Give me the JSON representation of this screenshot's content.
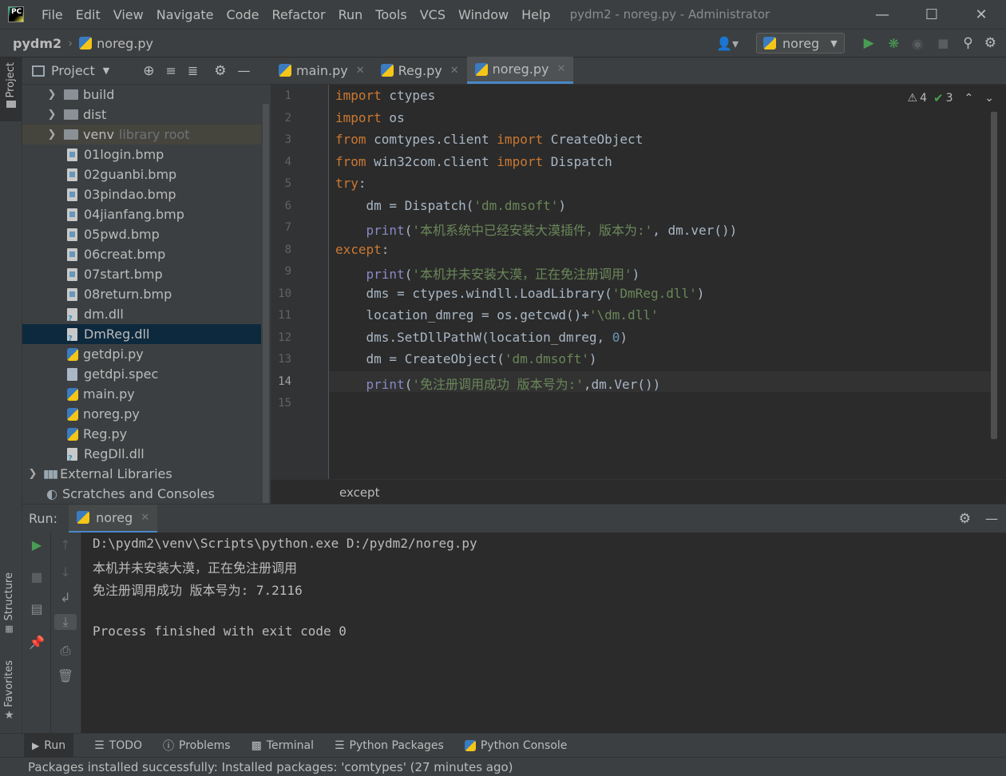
{
  "title_bar": {
    "menus": [
      "File",
      "Edit",
      "View",
      "Navigate",
      "Code",
      "Refactor",
      "Run",
      "Tools",
      "VCS",
      "Window",
      "Help"
    ],
    "window_title": "pydm2 - noreg.py - Administrator"
  },
  "nav_bar": {
    "project": "pydm2",
    "file": "noreg.py",
    "run_config": "noreg"
  },
  "left_strip": {
    "project_label": "Project",
    "structure_label": "Structure",
    "favorites_label": "Favorites"
  },
  "project_panel": {
    "title": "Project",
    "tree": [
      {
        "label": "build",
        "type": "folder",
        "collapsed": true
      },
      {
        "label": "dist",
        "type": "folder",
        "collapsed": true
      },
      {
        "label": "venv",
        "suffix": "library root",
        "type": "folder",
        "collapsed": true
      },
      {
        "label": "01login.bmp",
        "type": "bmp"
      },
      {
        "label": "02guanbi.bmp",
        "type": "bmp"
      },
      {
        "label": "03pindao.bmp",
        "type": "bmp"
      },
      {
        "label": "04jianfang.bmp",
        "type": "bmp"
      },
      {
        "label": "05pwd.bmp",
        "type": "bmp"
      },
      {
        "label": "06creat.bmp",
        "type": "bmp"
      },
      {
        "label": "07start.bmp",
        "type": "bmp"
      },
      {
        "label": "08return.bmp",
        "type": "bmp"
      },
      {
        "label": "dm.dll",
        "type": "dll"
      },
      {
        "label": "DmReg.dll",
        "type": "dll",
        "selected": true
      },
      {
        "label": "getdpi.py",
        "type": "py"
      },
      {
        "label": "getdpi.spec",
        "type": "spec"
      },
      {
        "label": "main.py",
        "type": "py"
      },
      {
        "label": "noreg.py",
        "type": "py"
      },
      {
        "label": "Reg.py",
        "type": "py"
      },
      {
        "label": "RegDll.dll",
        "type": "dll"
      }
    ],
    "external_libraries": "External Libraries",
    "scratches": "Scratches and Consoles"
  },
  "editor": {
    "tabs": [
      {
        "label": "main.py",
        "active": false
      },
      {
        "label": "Reg.py",
        "active": false
      },
      {
        "label": "noreg.py",
        "active": true
      }
    ],
    "inspection": {
      "warnings": "4",
      "ok": "3"
    },
    "line_numbers": [
      "1",
      "2",
      "3",
      "4",
      "5",
      "6",
      "7",
      "8",
      "9",
      "10",
      "11",
      "12",
      "13",
      "14",
      "15"
    ],
    "breadcrumb": "except"
  },
  "run_panel": {
    "label": "Run:",
    "tab": "noreg",
    "output": [
      "D:\\pydm2\\venv\\Scripts\\python.exe D:/pydm2/noreg.py",
      "本机并未安装大漠，正在免注册调用",
      "免注册调用成功 版本号为: 7.2116",
      "",
      "Process finished with exit code 0"
    ]
  },
  "tool_windows": [
    "Run",
    "TODO",
    "Problems",
    "Terminal",
    "Python Packages",
    "Python Console"
  ],
  "status_bar": {
    "message": "Packages installed successfully: Installed packages: 'comtypes' (27 minutes ago)"
  },
  "colors": {
    "accent": "#4a88c7",
    "run_green": "#499c54",
    "keyword": "#cc7832",
    "string": "#6a8759"
  }
}
